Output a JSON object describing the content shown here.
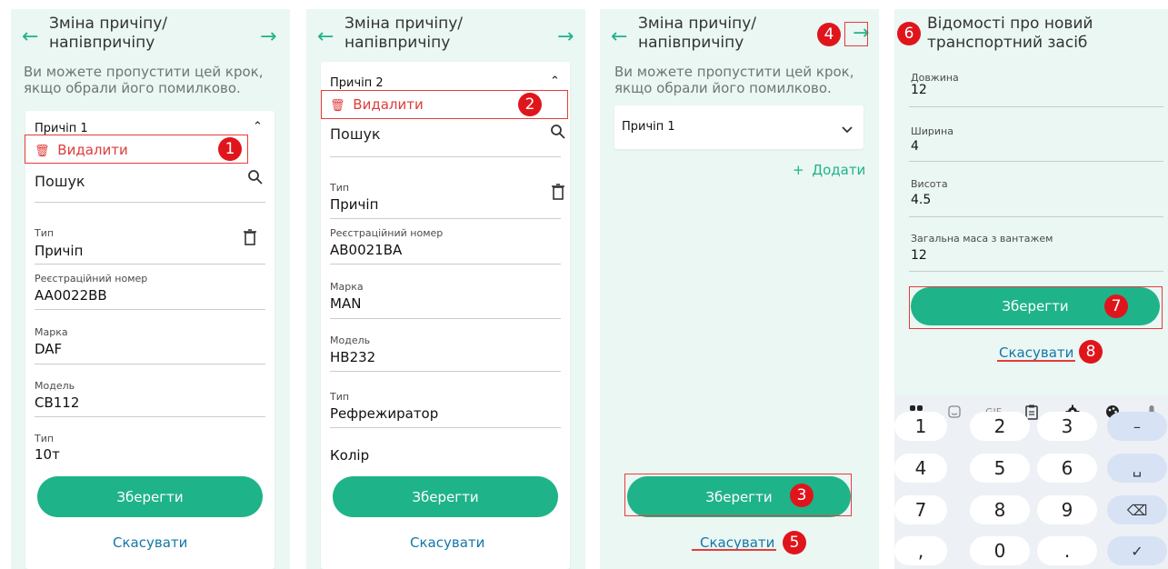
{
  "screens": [
    {
      "title": "Зміна причіпу/\nнапівпричіпу",
      "hint": "Ви можете пропустити цей крок,\nякщо обрали його помилково.",
      "trailer_title": "Причіп 1",
      "delete_label": "Видалити",
      "search_label": "Пошук",
      "fields": [
        {
          "label": "Тип",
          "value": "Причіп"
        },
        {
          "label": "Реєстраційний номер",
          "value": "AA0022BB"
        },
        {
          "label": "Марка",
          "value": "DAF"
        },
        {
          "label": "Модель",
          "value": "CB112"
        },
        {
          "label": "Тип",
          "value": "10т"
        }
      ],
      "save_label": "Зберегти",
      "cancel_label": "Скасувати"
    },
    {
      "title": "Зміна причіпу/\nнапівпричіпу",
      "trailer_title": "Причіп 2",
      "delete_label": "Видалити",
      "search_label": "Пошук",
      "fields": [
        {
          "label": "Тип",
          "value": "Причіп"
        },
        {
          "label": "Реєстраційний номер",
          "value": "AB0021BA"
        },
        {
          "label": "Марка",
          "value": "MAN"
        },
        {
          "label": "Модель",
          "value": "HB232"
        },
        {
          "label": "Тип",
          "value": "Рефрежиратор"
        },
        {
          "label": "",
          "value": "Колір"
        }
      ],
      "save_label": "Зберегти",
      "cancel_label": "Скасувати"
    },
    {
      "title": "Зміна причіпу/\nнапівпричіпу",
      "hint": "Ви можете пропустити цей крок,\nякщо обрали його помилково.",
      "trailer_title": "Причіп 1",
      "add_label": "Додати",
      "save_label": "Зберегти",
      "cancel_label": "Скасувати"
    },
    {
      "title": "Відомості про новий\nтранспортний засіб",
      "fields": [
        {
          "label": "Довжина",
          "value": "12"
        },
        {
          "label": "Ширина",
          "value": "4"
        },
        {
          "label": "Висота",
          "value": "4.5"
        },
        {
          "label": "Загальна маса з вантажем",
          "value": "12"
        }
      ],
      "save_label": "Зберегти",
      "cancel_label": "Скасувати"
    }
  ],
  "badges": [
    "1",
    "2",
    "3",
    "4",
    "5",
    "6",
    "7",
    "8"
  ],
  "keyboard": {
    "toolbar": [
      "apps-icon",
      "sticker-icon",
      "GIF",
      "clipboard-icon",
      "settings-icon",
      "palette-icon",
      "mic-icon"
    ],
    "gif_label": "GIF",
    "rows": [
      [
        "1",
        "2",
        "3",
        "–"
      ],
      [
        "4",
        "5",
        "6",
        "␣"
      ],
      [
        "7",
        "8",
        "9",
        "⌫"
      ],
      [
        ",",
        "0",
        ".",
        "✓"
      ]
    ]
  },
  "colors": {
    "accent": "#1fb389",
    "danger": "#e03a3a",
    "link": "#1577a8",
    "annotation": "#e0151c",
    "panel_bg": "#eaf7f3"
  }
}
